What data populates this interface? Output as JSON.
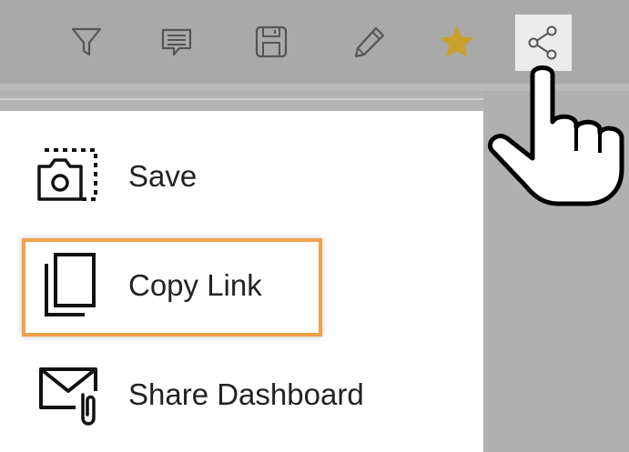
{
  "toolbar": {
    "icons": [
      {
        "name": "filter-icon"
      },
      {
        "name": "comment-icon"
      },
      {
        "name": "save-icon"
      },
      {
        "name": "edit-icon"
      },
      {
        "name": "star-icon"
      },
      {
        "name": "share-icon"
      }
    ],
    "star_color": "#c8a02a"
  },
  "share_menu": {
    "items": [
      {
        "label": "Save",
        "icon": "camera-snapshot-icon"
      },
      {
        "label": "Copy Link",
        "icon": "copy-icon"
      },
      {
        "label": "Share Dashboard",
        "icon": "mail-attachment-icon"
      }
    ],
    "highlighted_item": "Copy Link",
    "highlight_color": "#f0a04b"
  },
  "cursor": {
    "icon": "hand-pointer-icon"
  }
}
